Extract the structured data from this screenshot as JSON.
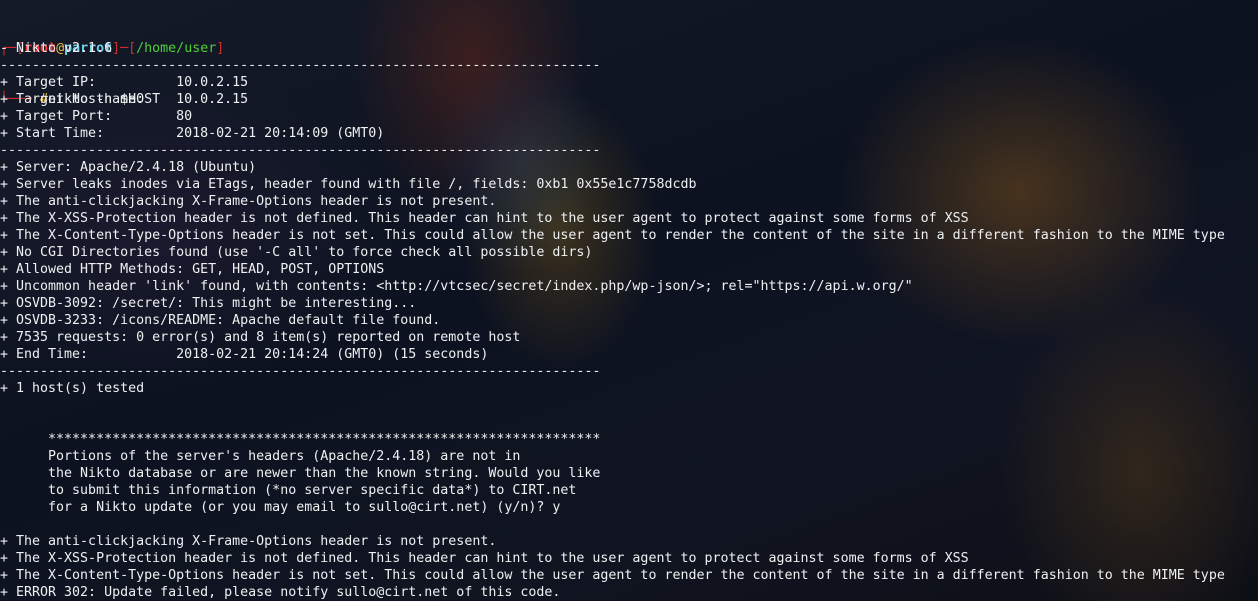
{
  "prompt": {
    "open_bracket": "┌─[",
    "user": "root",
    "at": "@",
    "host": "parrot",
    "mid_bracket": "]─[",
    "path": "/home/user",
    "close_bracket": "]",
    "second_prefix": "└──╼ ",
    "symbol": "#",
    "command": "nikto -h $HOST"
  },
  "output_lines": [
    "- Nikto v2.1.6",
    "---------------------------------------------------------------------------",
    "+ Target IP:          10.0.2.15",
    "+ Target Hostname:    10.0.2.15",
    "+ Target Port:        80",
    "+ Start Time:         2018-02-21 20:14:09 (GMT0)",
    "---------------------------------------------------------------------------",
    "+ Server: Apache/2.4.18 (Ubuntu)",
    "+ Server leaks inodes via ETags, header found with file /, fields: 0xb1 0x55e1c7758dcdb",
    "+ The anti-clickjacking X-Frame-Options header is not present.",
    "+ The X-XSS-Protection header is not defined. This header can hint to the user agent to protect against some forms of XSS",
    "+ The X-Content-Type-Options header is not set. This could allow the user agent to render the content of the site in a different fashion to the MIME type",
    "+ No CGI Directories found (use '-C all' to force check all possible dirs)",
    "+ Allowed HTTP Methods: GET, HEAD, POST, OPTIONS",
    "+ Uncommon header 'link' found, with contents: <http://vtcsec/secret/index.php/wp-json/>; rel=\"https://api.w.org/\"",
    "+ OSVDB-3092: /secret/: This might be interesting...",
    "+ OSVDB-3233: /icons/README: Apache default file found.",
    "+ 7535 requests: 0 error(s) and 8 item(s) reported on remote host",
    "+ End Time:           2018-02-21 20:14:24 (GMT0) (15 seconds)",
    "---------------------------------------------------------------------------",
    "+ 1 host(s) tested",
    "",
    "",
    "      *********************************************************************",
    "      Portions of the server's headers (Apache/2.4.18) are not in",
    "      the Nikto database or are newer than the known string. Would you like",
    "      to submit this information (*no server specific data*) to CIRT.net",
    "      for a Nikto update (or you may email to sullo@cirt.net) (y/n)? y",
    "",
    "+ The anti-clickjacking X-Frame-Options header is not present.",
    "+ The X-XSS-Protection header is not defined. This header can hint to the user agent to protect against some forms of XSS",
    "+ The X-Content-Type-Options header is not set. This could allow the user agent to render the content of the site in a different fashion to the MIME type",
    "+ ERROR 302: Update failed, please notify sullo@cirt.net of this code."
  ],
  "colors": {
    "prompt_bracket": "#d22b2b",
    "prompt_user": "#ff3b3b",
    "prompt_host": "#6fd2ea",
    "prompt_path": "#4fcf3a",
    "prompt_symbol": "#f0c040",
    "text": "#eef0f2"
  }
}
